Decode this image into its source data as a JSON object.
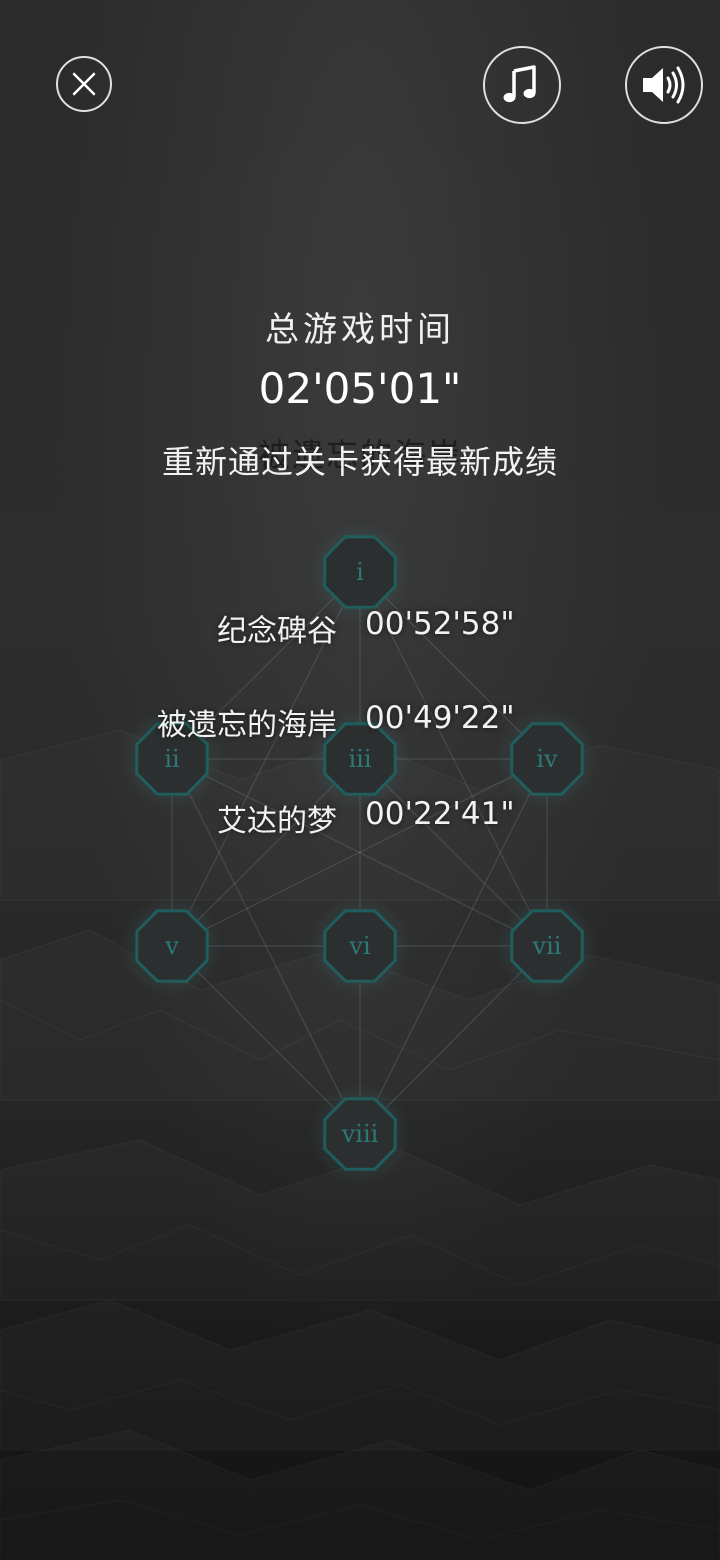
{
  "header": {
    "close_icon": "close-icon",
    "music_icon": "music-note-icon",
    "sound_icon": "speaker-volume-icon"
  },
  "summary": {
    "title": "总游戏时间",
    "total_time": "02'05'01\"",
    "ghost_level_name": "被遗忘的海岸",
    "replay_hint": "重新通过关卡获得最新成绩"
  },
  "level_map": {
    "nodes": [
      "i",
      "ii",
      "iii",
      "iv",
      "v",
      "vi",
      "vii",
      "viii"
    ],
    "node_border_color": "#1f5e5c",
    "node_text_color": "#2c7a78"
  },
  "records": [
    {
      "name": "纪念碑谷",
      "time": "00'52'58\""
    },
    {
      "name": "被遗忘的海岸",
      "time": "00'49'22\""
    },
    {
      "name": "艾达的梦",
      "time": "00'22'41\""
    }
  ]
}
